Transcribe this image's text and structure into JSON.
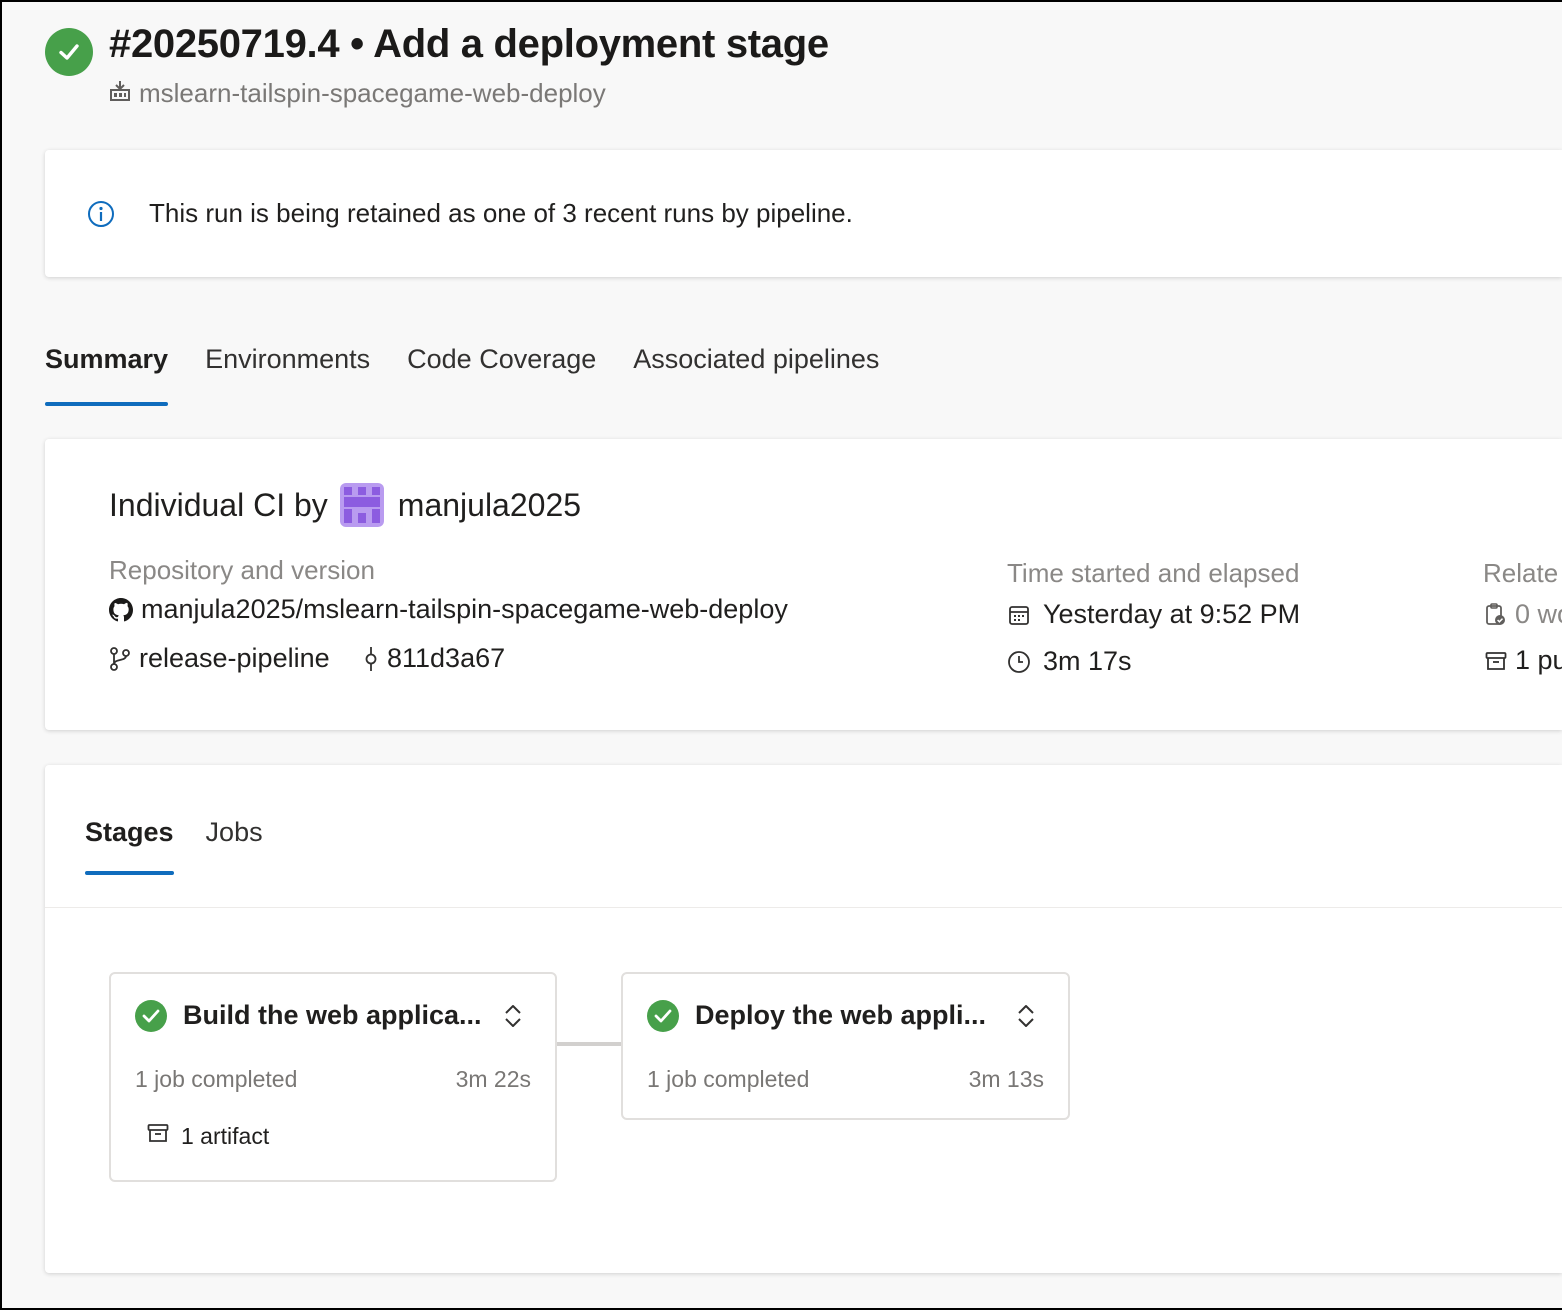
{
  "header": {
    "title": "#20250719.4 • Add a deployment stage",
    "pipeline_name": "mslearn-tailspin-spacegame-web-deploy",
    "status": "succeeded"
  },
  "banner": {
    "text": "This run is being retained as one of 3 recent runs by pipeline."
  },
  "tabs": [
    {
      "label": "Summary",
      "active": true
    },
    {
      "label": "Environments"
    },
    {
      "label": "Code Coverage"
    },
    {
      "label": "Associated pipelines"
    }
  ],
  "summary": {
    "trigger_prefix": "Individual CI by",
    "user": "manjula2025",
    "repo_label": "Repository and version",
    "repo": "manjula2025/mslearn-tailspin-spacegame-web-deploy",
    "branch": "release-pipeline",
    "commit": "811d3a67",
    "time_label": "Time started and elapsed",
    "started": "Yesterday at 9:52 PM",
    "elapsed": "3m 17s",
    "related_label": "Relate",
    "related_work": "0 wo",
    "related_published": "1 pu"
  },
  "stages_tabs": [
    {
      "label": "Stages",
      "active": true
    },
    {
      "label": "Jobs"
    }
  ],
  "stages": [
    {
      "name": "Build the web applica...",
      "jobs": "1 job completed",
      "duration": "3m 22s",
      "artifact": "1 artifact"
    },
    {
      "name": "Deploy the web appli...",
      "jobs": "1 job completed",
      "duration": "3m 13s"
    }
  ],
  "colors": {
    "success": "#47a04a",
    "accent": "#0f6cbd",
    "avatar": "#8c5ce0"
  }
}
